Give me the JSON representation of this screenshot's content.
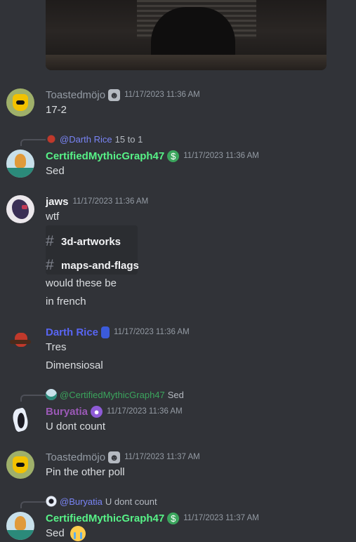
{
  "messages": [
    {
      "username": "Toastedmöjo",
      "badge_icon": "ghost-icon",
      "timestamp": "11/17/2023 11:36 AM",
      "lines": [
        "17-2"
      ]
    },
    {
      "reply": {
        "mention": "@Darth Rice",
        "text": "15 to 1"
      },
      "username": "CertifiedMythicGraph47",
      "badge_icon": "money-icon",
      "timestamp": "11/17/2023 11:36 AM",
      "lines": [
        "Sed"
      ]
    },
    {
      "username": "jaws",
      "timestamp": "11/17/2023 11:36 AM",
      "lines": [
        "wtf"
      ],
      "channels": [
        "3d-artworks",
        "maps-and-flags"
      ],
      "after_lines": [
        "would these be",
        "in french"
      ]
    },
    {
      "username": "Darth Rice",
      "badge_icon": "bottle-icon",
      "timestamp": "11/17/2023 11:36 AM",
      "lines": [
        "Tres",
        "Dimensiosal"
      ]
    },
    {
      "reply": {
        "mention": "@CertifiedMythicGraph47",
        "text": "Sed"
      },
      "username": "Buryatia",
      "badge_icon": "orb-icon",
      "timestamp": "11/17/2023 11:36 AM",
      "lines": [
        "U dont count"
      ]
    },
    {
      "username": "Toastedmöjo",
      "badge_icon": "ghost-icon",
      "timestamp": "11/17/2023 11:37 AM",
      "lines": [
        "Pin the other poll"
      ]
    },
    {
      "reply": {
        "mention": "@Buryatia",
        "text": "U dont count"
      },
      "username": "CertifiedMythicGraph47",
      "badge_icon": "money-icon",
      "timestamp": "11/17/2023 11:37 AM",
      "lines": [
        "Sed"
      ],
      "emoji": "loudly-crying-emoji"
    }
  ],
  "colors": {
    "background": "#313338",
    "text": "#dbdee1",
    "timestamp": "#949ba4",
    "certified_name": "#57f287",
    "darth_name": "#5865f2",
    "buryatia_name": "#9b59b6",
    "mention": "#7984f5"
  }
}
